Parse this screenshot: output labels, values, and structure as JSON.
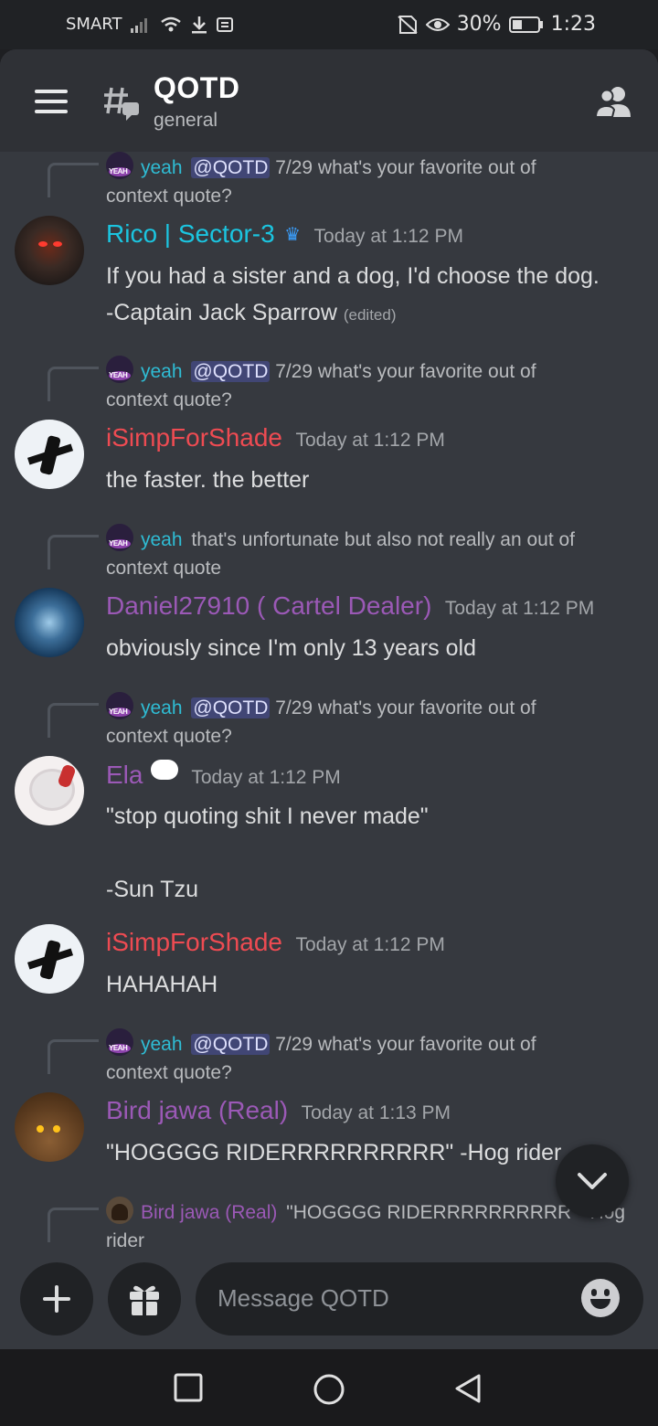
{
  "status_bar": {
    "carrier": "SMART",
    "battery": "30%",
    "time": "1:23"
  },
  "header": {
    "title": "QOTD",
    "subtitle": "general"
  },
  "messages": [
    {
      "reply": {
        "author": "yeah",
        "mention": "@QOTD",
        "text_line1": "7/29 what's your favorite out of",
        "text_line2": "context quote?"
      },
      "author": "Rico | Sector-3",
      "timestamp": "Today at 1:12 PM",
      "lines": [
        "If you had a sister and a dog, I'd choose the dog.",
        "-Captain Jack Sparrow"
      ],
      "edited": "(edited)"
    },
    {
      "reply": {
        "author": "yeah",
        "mention": "@QOTD",
        "text_line1": "7/29 what's your favorite out of",
        "text_line2": "context quote?"
      },
      "author": "iSimpForShade",
      "timestamp": "Today at 1:12 PM",
      "lines": [
        "the faster. the better"
      ]
    },
    {
      "reply": {
        "author": "yeah",
        "text_line1": "that's unfortunate but also not really an out of",
        "text_line2": "context quote"
      },
      "author": "Daniel27910 ( Cartel Dealer)",
      "timestamp": "Today at 1:12 PM",
      "lines": [
        "obviously since I'm only 13 years old"
      ]
    },
    {
      "reply": {
        "author": "yeah",
        "mention": "@QOTD",
        "text_line1": "7/29 what's your favorite out of",
        "text_line2": "context quote?"
      },
      "author": "Ela",
      "timestamp": "Today at 1:12 PM",
      "lines": [
        "\"stop quoting shit I never made\"",
        "",
        "-Sun Tzu"
      ]
    },
    {
      "author": "iSimpForShade",
      "timestamp": "Today at 1:12 PM",
      "lines": [
        "HAHAHAH"
      ]
    },
    {
      "reply": {
        "author": "yeah",
        "mention": "@QOTD",
        "text_line1": "7/29 what's your favorite out of",
        "text_line2": "context quote?"
      },
      "author": "Bird jawa (Real)",
      "timestamp": "Today at 1:13 PM",
      "lines": [
        "\"HOGGGG RIDERRRRRRRRRR\" -Hog rider"
      ]
    },
    {
      "reply": {
        "author": "Bird jawa (Real)",
        "text_line1": "\"HOGGGG RIDERRRRRRRRRR\" -Hog",
        "text_line2": "rider"
      }
    }
  ],
  "composer": {
    "placeholder": "Message QOTD"
  },
  "icons": {
    "menu": "hamburger-icon",
    "channel": "thread-icon",
    "members": "members-icon",
    "add": "plus-icon",
    "gift": "gift-icon",
    "emoji": "emoji-icon",
    "jump": "chevron-down-icon"
  },
  "colors": {
    "background": "#36393f",
    "header": "#2f3136",
    "name_cyan": "#1bc5e0",
    "name_red": "#ee4b52",
    "name_purple": "#9b59b6"
  }
}
